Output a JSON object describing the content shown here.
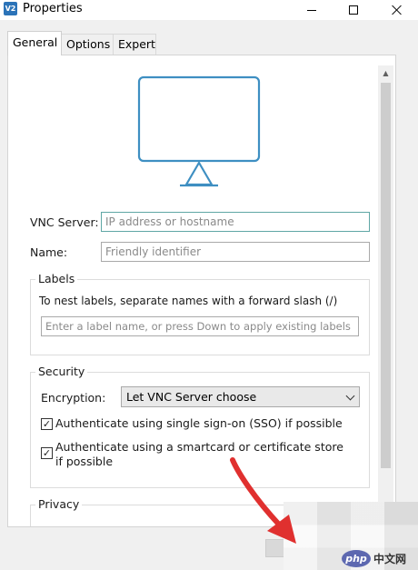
{
  "window": {
    "title": "Properties",
    "icon_text": "V2",
    "icon": "vnc-app-icon",
    "controls": [
      "minimize-icon",
      "maximize-icon",
      "close-icon"
    ]
  },
  "tabs": [
    {
      "label": "General",
      "active": true
    },
    {
      "label": "Options",
      "active": false
    },
    {
      "label": "Expert",
      "active": false
    }
  ],
  "general": {
    "monitor_icon": "monitor-icon",
    "vnc_server": {
      "label": "VNC Server:",
      "placeholder": "IP address or hostname",
      "value": ""
    },
    "name": {
      "label": "Name:",
      "placeholder": "Friendly identifier",
      "value": ""
    },
    "labels": {
      "title": "Labels",
      "help": "To nest labels, separate names with a forward slash (/)",
      "placeholder": "Enter a label name, or press Down to apply existing labels"
    },
    "security": {
      "title": "Security",
      "encryption_label": "Encryption:",
      "encryption_value": "Let VNC Server choose",
      "sso": {
        "label": "Authenticate using single sign-on (SSO) if possible",
        "checked": true,
        "mark": "✓"
      },
      "smartcard": {
        "label": "Authenticate using a smartcard or certificate store if possible",
        "checked": true,
        "mark": "✓"
      }
    },
    "privacy": {
      "title": "Privacy"
    }
  },
  "watermark": {
    "logo": "php",
    "text": "中文网"
  },
  "colors": {
    "accent_teal": "#5fa7a5",
    "monitor_stroke": "#3e8fc2",
    "arrow_red": "#e0302f",
    "watermark_blue": "#5d68b0"
  }
}
